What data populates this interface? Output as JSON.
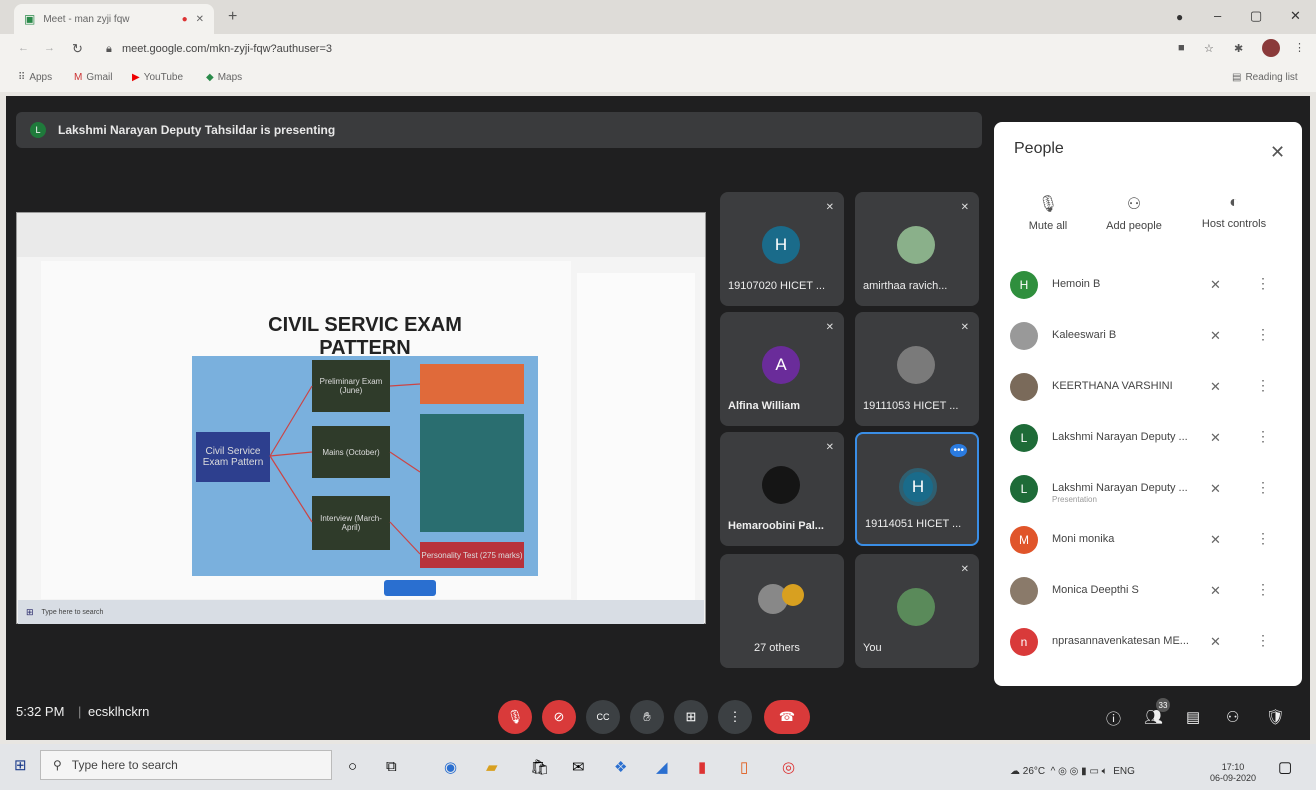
{
  "browser": {
    "tab_title": "Meet - man zyji fqw",
    "url": "meet.google.com/mkn-zyji-fqw?authuser=3",
    "bookmarks": [
      "Apps",
      "Gmail",
      "YouTube",
      "Maps"
    ],
    "reading_list": "Reading list"
  },
  "meet": {
    "presenting_text": "Lakshmi Narayan Deputy Tahsildar is presenting",
    "presenter_initial": "L",
    "slide_title": "CIVIL SERVIC EXAM PATTERN",
    "diagram_labels": [
      "Civil Service Exam Pattern",
      "Preliminary Exam (June)",
      "Mains (October)",
      "Interview (March-April)",
      "Personality Test (275 marks)"
    ],
    "shared_taskbar_search": "Type here to search",
    "time": "5:32 PM",
    "meeting_code": "ecsklhckrn",
    "tiles": [
      {
        "initial": "H",
        "name": "19107020 HICET ..."
      },
      {
        "initial": "",
        "name": "amirthaa ravich..."
      },
      {
        "initial": "A",
        "name": "Alfina William"
      },
      {
        "initial": "",
        "name": "19111053 HICET ..."
      },
      {
        "initial": "",
        "name": "Hemaroobini Pal..."
      },
      {
        "initial": "H",
        "name": "19114051 HICET ..."
      },
      {
        "initial": "",
        "name": "27 others"
      },
      {
        "initial": "",
        "name": "You"
      }
    ],
    "participant_count": "33"
  },
  "people_panel": {
    "title": "People",
    "controls": [
      "Mute all",
      "Add people",
      "Host controls"
    ],
    "people": [
      {
        "initial": "H",
        "name": "Hemoin B",
        "sub": "",
        "color": "#2f8f3d"
      },
      {
        "initial": "",
        "name": "Kaleeswari B",
        "sub": "",
        "color": "#999999"
      },
      {
        "initial": "",
        "name": "KEERTHANA VARSHINI",
        "sub": "",
        "color": "#7a6a5a"
      },
      {
        "initial": "L",
        "name": "Lakshmi Narayan Deputy ...",
        "sub": "",
        "color": "#1e6b38"
      },
      {
        "initial": "L",
        "name": "Lakshmi Narayan Deputy ...",
        "sub": "Presentation",
        "color": "#1e6b38"
      },
      {
        "initial": "M",
        "name": "Moni monika",
        "sub": "",
        "color": "#e0552a"
      },
      {
        "initial": "",
        "name": "Monica Deepthi S",
        "sub": "",
        "color": "#8a7a6a"
      },
      {
        "initial": "n",
        "name": "nprasannavenkatesan ME...",
        "sub": "",
        "color": "#d93a3a"
      }
    ]
  },
  "taskbar": {
    "search_placeholder": "Type here to search",
    "weather": "26°C",
    "language": "ENG",
    "time": "17:10",
    "date": "06-09-2020"
  }
}
